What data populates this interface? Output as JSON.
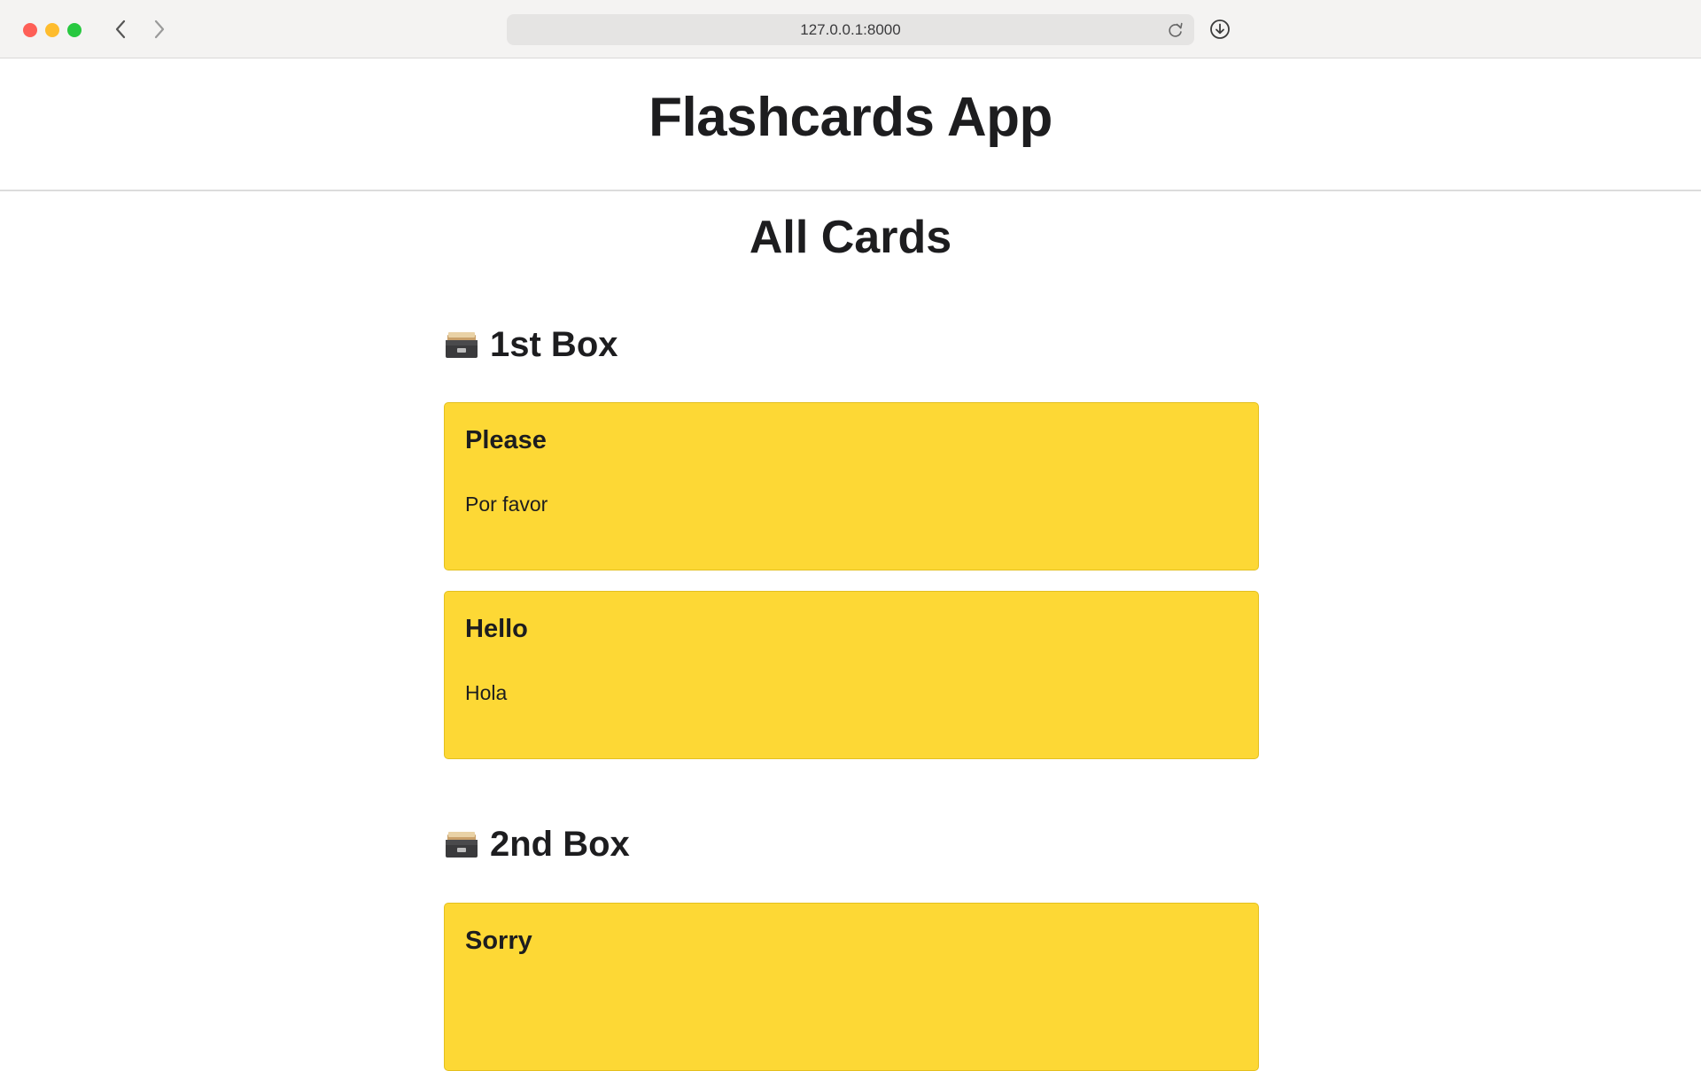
{
  "browser": {
    "url": "127.0.0.1:8000"
  },
  "app": {
    "title": "Flashcards App"
  },
  "main": {
    "section_title": "All Cards",
    "boxes": [
      {
        "label": "1st Box",
        "cards": [
          {
            "front": "Please",
            "back": "Por favor"
          },
          {
            "front": "Hello",
            "back": "Hola"
          }
        ]
      },
      {
        "label": "2nd Box",
        "cards": [
          {
            "front": "Sorry",
            "back": ""
          }
        ]
      }
    ]
  },
  "icons": {
    "box_icon": "card-file-box-icon"
  },
  "colors": {
    "card_background": "#fdd835",
    "card_border": "#e3c01f",
    "chrome_background": "#f4f3f2"
  }
}
